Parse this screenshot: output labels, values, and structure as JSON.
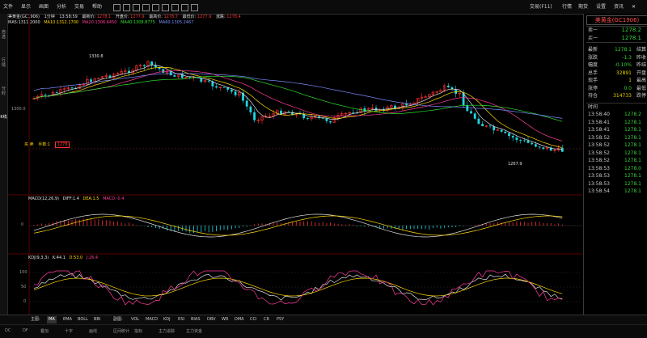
{
  "toolbar": {
    "items": [
      "文件",
      "显示",
      "画面",
      "分析",
      "交易",
      "帮助"
    ],
    "right": [
      "交易(F11)",
      "行情",
      "期货",
      "设置",
      "资讯"
    ]
  },
  "left_tabs": [
    "自选",
    "行情",
    "分时",
    "K线"
  ],
  "main_chart": {
    "header": {
      "symbol": "美黄金(GC1906)",
      "period": "1分钟",
      "time_label": "13:58:59",
      "latest_label": "最新价:",
      "latest_value": "1278.1",
      "open_label": "开盘价:",
      "open_value": "1277.9",
      "high_label": "最高价:",
      "high_value": "1278.7",
      "low_label": "最低价:",
      "low_value": "1277.9",
      "close_label": "涨跌:",
      "close_value": "1278.4"
    },
    "ma_legend": [
      {
        "text": "MA5:1311.2000",
        "color": "#e0e0e0"
      },
      {
        "text": "MA10:1312.1700",
        "color": "#ffd800"
      },
      {
        "text": "MA20:1306.6450",
        "color": "#ff3b9c"
      },
      {
        "text": "MA40:1308.8775",
        "color": "#2fe12f"
      },
      {
        "text": "MA60:1305.2467",
        "color": "#7a8cff"
      }
    ],
    "price_label_1300": "1300.0",
    "high_marker": "1330.8",
    "low_marker": "1267.9",
    "buy_sell": {
      "buy": "买 卖",
      "hand": "手数:1",
      "price": "1278"
    }
  },
  "macd_legend": [
    {
      "text": "MACD(12,26,9)",
      "color": "#e0e0e0"
    },
    {
      "text": "DIFF:1.4",
      "color": "#e0e0e0"
    },
    {
      "text": "DEA:1.5",
      "color": "#ffd800"
    },
    {
      "text": "MACD:-0.4",
      "color": "#ff3b9c"
    }
  ],
  "macd_zero": "0",
  "kdj_legend": [
    {
      "text": "KDJ(9,3,3)",
      "color": "#e0e0e0"
    },
    {
      "text": "K:44.1",
      "color": "#e0e0e0"
    },
    {
      "text": "D:53.0",
      "color": "#ffd800"
    },
    {
      "text": "J:26.4",
      "color": "#ff3b9c"
    }
  ],
  "kdj_ticks": [
    "100",
    "50",
    "0"
  ],
  "right_panel": {
    "title": "美黄金(GC1906)",
    "sell_label": "卖一",
    "sell_value": "1278.2",
    "buy_label": "买一",
    "buy_value": "1278.1",
    "stats": [
      {
        "k": "最新",
        "v": "1278.1",
        "k2": "结算",
        "color": "#38d138"
      },
      {
        "k": "涨跌",
        "v": "-1.3",
        "k2": "昨收",
        "color": "#38d138"
      },
      {
        "k": "幅度",
        "v": "-0.10%",
        "k2": "昨结",
        "color": "#38d138"
      },
      {
        "k": "总手",
        "v": "32891",
        "k2": "开盘",
        "color": "#e6d200"
      },
      {
        "k": "现手",
        "v": "1",
        "k2": "最高",
        "color": "#e6d200"
      },
      {
        "k": "涨停",
        "v": "0.0",
        "k2": "最低",
        "color": "#38d138"
      },
      {
        "k": "持仓",
        "v": "314733",
        "k2": "跌停",
        "color": "#e6d200"
      }
    ],
    "ticks_header": "时间",
    "ticks": [
      {
        "time": "13:58:40",
        "price": "1278.2"
      },
      {
        "time": "13:58:41",
        "price": "1278.1"
      },
      {
        "time": "13:58:41",
        "price": "1278.1"
      },
      {
        "time": "13:58:52",
        "price": "1278.1"
      },
      {
        "time": "13:58:52",
        "price": "1278.1"
      },
      {
        "time": "13:58:52",
        "price": "1278.1"
      },
      {
        "time": "13:58:52",
        "price": "1278.1"
      },
      {
        "time": "13:58:53",
        "price": "1278.0"
      },
      {
        "time": "13:58:53",
        "price": "1278.1"
      },
      {
        "time": "13:58:53",
        "price": "1278.1"
      },
      {
        "time": "13:58:54",
        "price": "1278.1"
      }
    ]
  },
  "bottom_bar": {
    "label": "主图:",
    "main": [
      "MA",
      "EMA",
      "BOLL",
      "BBI"
    ],
    "sub_label": "副图:",
    "sub": [
      "VOL",
      "MACD",
      "KDJ",
      "RSI",
      "BIAS",
      "DBV",
      "WR",
      "DMA",
      "CCI",
      "CR",
      "PSY"
    ]
  },
  "status_bar": [
    "DC",
    "DF",
    "叠加",
    "十字",
    "画线",
    "区间统计",
    "指标",
    "主力追踪",
    "主力资金"
  ],
  "colors": {
    "up": "#ff3030",
    "down": "#1fd6e0",
    "grid": "#5a0000"
  }
}
